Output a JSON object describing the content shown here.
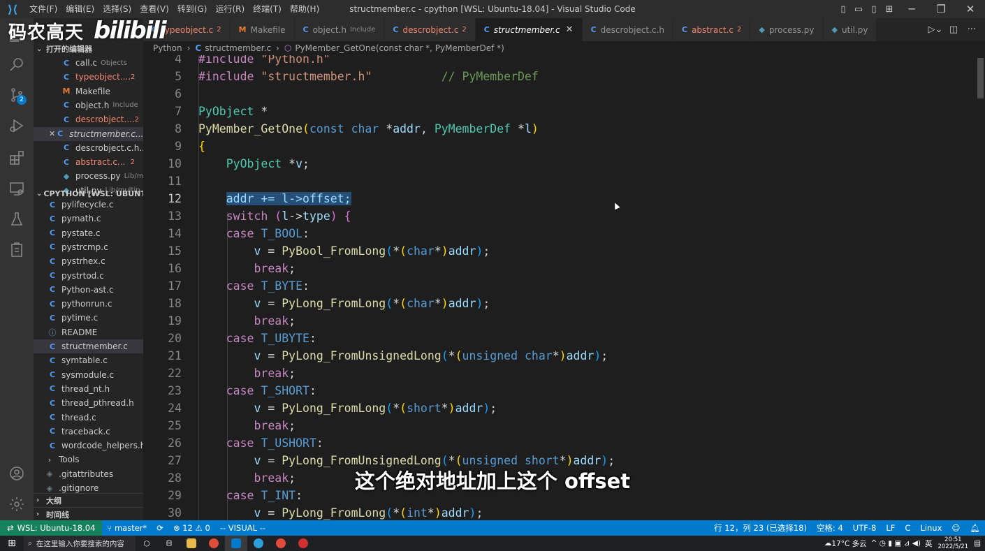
{
  "window": {
    "title": "structmember.c - cpython [WSL: Ubuntu-18.04] - Visual Studio Code",
    "menu": [
      "文件(F)",
      "编辑(E)",
      "选择(S)",
      "查看(V)",
      "转到(G)",
      "运行(R)",
      "终端(T)",
      "帮助(H)"
    ],
    "controls": {
      "minimize": "─",
      "restore": "❐",
      "close": "✕"
    }
  },
  "watermark": {
    "text": "码农高天",
    "logo": "bilibili"
  },
  "subtitle": "这个绝对地址加上这个 offset",
  "activity_bar": {
    "icons": [
      "explorer-icon",
      "search-icon",
      "source-control-icon",
      "run-debug-icon",
      "extensions-icon",
      "remote-explorer-icon",
      "testing-icon",
      "clipboard-icon",
      "account-icon",
      "settings-gear-icon"
    ],
    "source_control_badge": "2"
  },
  "sidebar": {
    "open_editors_header": "打开的编辑器",
    "open_editors": [
      {
        "icon": "C",
        "name": "call.c",
        "desc": "Objects",
        "badge": "",
        "err": false
      },
      {
        "icon": "C",
        "name": "typeobject....",
        "desc": "",
        "badge": "2",
        "err": true
      },
      {
        "icon": "M",
        "name": "Makefile",
        "desc": "",
        "badge": "",
        "err": false
      },
      {
        "icon": "C",
        "name": "object.h",
        "desc": "Include",
        "badge": "",
        "err": false
      },
      {
        "icon": "C",
        "name": "descrobject....",
        "desc": "",
        "badge": "2",
        "err": true
      },
      {
        "icon": "C",
        "name": "structmember.c...",
        "desc": "",
        "badge": "",
        "err": false,
        "active": true
      },
      {
        "icon": "C",
        "name": "descrobject.c.h...",
        "desc": "",
        "badge": "",
        "err": false
      },
      {
        "icon": "C",
        "name": "abstract.c...",
        "desc": "",
        "badge": "2",
        "err": true
      },
      {
        "icon": "PY",
        "name": "process.py",
        "desc": "Lib/m...",
        "badge": "",
        "err": false
      },
      {
        "icon": "PY",
        "name": "util.py",
        "desc": "Lib/multip...",
        "badge": "",
        "err": false
      }
    ],
    "workspace_header": "CPYTHON [WSL: UBUNTU-...",
    "files": [
      {
        "icon": "C",
        "name": "pylifecycle.c"
      },
      {
        "icon": "C",
        "name": "pymath.c"
      },
      {
        "icon": "C",
        "name": "pystate.c"
      },
      {
        "icon": "C",
        "name": "pystrcmp.c"
      },
      {
        "icon": "C",
        "name": "pystrhex.c"
      },
      {
        "icon": "C",
        "name": "pystrtod.c"
      },
      {
        "icon": "C",
        "name": "Python-ast.c"
      },
      {
        "icon": "C",
        "name": "pythonrun.c"
      },
      {
        "icon": "C",
        "name": "pytime.c"
      },
      {
        "icon": "ⓘ",
        "name": "README"
      },
      {
        "icon": "C",
        "name": "structmember.c",
        "active": true
      },
      {
        "icon": "C",
        "name": "symtable.c"
      },
      {
        "icon": "C",
        "name": "sysmodule.c"
      },
      {
        "icon": "C",
        "name": "thread_nt.h"
      },
      {
        "icon": "C",
        "name": "thread_pthread.h"
      },
      {
        "icon": "C",
        "name": "thread.c"
      },
      {
        "icon": "C",
        "name": "traceback.c"
      },
      {
        "icon": "C",
        "name": "wordcode_helpers.h"
      },
      {
        "icon": "›",
        "name": "Tools"
      },
      {
        "icon": "◈",
        "name": ".gitattributes"
      },
      {
        "icon": "◈",
        "name": ".gitignore"
      }
    ],
    "outline_header": "大纲",
    "timeline_header": "时间线"
  },
  "tabs": [
    {
      "icon": "C",
      "name": "typeobject.c",
      "badge": "2",
      "err": true,
      "active": false,
      "desc": ""
    },
    {
      "icon": "M",
      "name": "Makefile",
      "badge": "",
      "err": false,
      "active": false,
      "desc": ""
    },
    {
      "icon": "C",
      "name": "object.h",
      "badge": "",
      "err": false,
      "active": false,
      "desc": "Include"
    },
    {
      "icon": "C",
      "name": "descrobject.c",
      "badge": "2",
      "err": true,
      "active": false,
      "desc": ""
    },
    {
      "icon": "C",
      "name": "structmember.c",
      "badge": "",
      "err": false,
      "active": true,
      "desc": ""
    },
    {
      "icon": "C",
      "name": "descrobject.c.h",
      "badge": "",
      "err": false,
      "active": false,
      "desc": ""
    },
    {
      "icon": "C",
      "name": "abstract.c",
      "badge": "2",
      "err": true,
      "active": false,
      "desc": ""
    },
    {
      "icon": "PY",
      "name": "process.py",
      "badge": "",
      "err": false,
      "active": false,
      "desc": ""
    },
    {
      "icon": "PY",
      "name": "util.py",
      "badge": "",
      "err": false,
      "active": false,
      "desc": ""
    }
  ],
  "breadcrumbs": {
    "folder": "Python",
    "file": "structmember.c",
    "symbol": "PyMember_GetOne(const char *, PyMemberDef *)"
  },
  "editor": {
    "current_line": 12,
    "lines": [
      {
        "n": "4",
        "tokens": [
          [
            "#include",
            "macro"
          ],
          [
            " ",
            "plain"
          ],
          [
            "\"Python.h\"",
            "str"
          ]
        ]
      },
      {
        "n": "5",
        "tokens": [
          [
            "#include",
            "macro"
          ],
          [
            " ",
            "plain"
          ],
          [
            "\"structmember.h\"",
            "str"
          ],
          [
            "          ",
            "plain"
          ],
          [
            "// PyMemberDef",
            "com"
          ]
        ]
      },
      {
        "n": "6",
        "tokens": []
      },
      {
        "n": "7",
        "tokens": [
          [
            "PyObject",
            "type"
          ],
          [
            " *",
            "plain"
          ]
        ]
      },
      {
        "n": "8",
        "tokens": [
          [
            "PyMember_GetOne",
            "fn"
          ],
          [
            "(",
            "brace1"
          ],
          [
            "const",
            "kw"
          ],
          [
            " ",
            "plain"
          ],
          [
            "char",
            "kw"
          ],
          [
            " *",
            "plain"
          ],
          [
            "addr",
            "var"
          ],
          [
            ", ",
            "plain"
          ],
          [
            "PyMemberDef",
            "type"
          ],
          [
            " *",
            "plain"
          ],
          [
            "l",
            "var"
          ],
          [
            ")",
            "brace1"
          ]
        ]
      },
      {
        "n": "9",
        "tokens": [
          [
            "{",
            "brace1"
          ]
        ]
      },
      {
        "n": "10",
        "tokens": [
          [
            "    ",
            "plain"
          ],
          [
            "PyObject",
            "type"
          ],
          [
            " *",
            "plain"
          ],
          [
            "v",
            "var"
          ],
          [
            ";",
            "plain"
          ]
        ]
      },
      {
        "n": "11",
        "tokens": []
      },
      {
        "n": "12",
        "tokens": [
          [
            "    ",
            "plain"
          ],
          [
            "addr += l->offset;",
            "sel"
          ]
        ]
      },
      {
        "n": "13",
        "tokens": [
          [
            "    ",
            "plain"
          ],
          [
            "switch",
            "ctrl"
          ],
          [
            " ",
            "plain"
          ],
          [
            "(",
            "brace2"
          ],
          [
            "l",
            "var"
          ],
          [
            "->",
            "plain"
          ],
          [
            "type",
            "var"
          ],
          [
            ")",
            "brace2"
          ],
          [
            " ",
            "plain"
          ],
          [
            "{",
            "brace2"
          ]
        ]
      },
      {
        "n": "14",
        "tokens": [
          [
            "    ",
            "plain"
          ],
          [
            "case",
            "ctrl"
          ],
          [
            " ",
            "plain"
          ],
          [
            "T_BOOL",
            "kw"
          ],
          [
            ":",
            "plain"
          ]
        ]
      },
      {
        "n": "15",
        "tokens": [
          [
            "        ",
            "plain"
          ],
          [
            "v",
            "var"
          ],
          [
            " = ",
            "plain"
          ],
          [
            "PyBool_FromLong",
            "fn"
          ],
          [
            "(",
            "brace3"
          ],
          [
            "*",
            "plain"
          ],
          [
            "(",
            "brace1"
          ],
          [
            "char",
            "kw"
          ],
          [
            "*",
            "plain"
          ],
          [
            ")",
            "brace1"
          ],
          [
            "addr",
            "var"
          ],
          [
            ")",
            "brace3"
          ],
          [
            ";",
            "plain"
          ]
        ]
      },
      {
        "n": "16",
        "tokens": [
          [
            "        ",
            "plain"
          ],
          [
            "break",
            "ctrl"
          ],
          [
            ";",
            "plain"
          ]
        ]
      },
      {
        "n": "17",
        "tokens": [
          [
            "    ",
            "plain"
          ],
          [
            "case",
            "ctrl"
          ],
          [
            " ",
            "plain"
          ],
          [
            "T_BYTE",
            "kw"
          ],
          [
            ":",
            "plain"
          ]
        ]
      },
      {
        "n": "18",
        "tokens": [
          [
            "        ",
            "plain"
          ],
          [
            "v",
            "var"
          ],
          [
            " = ",
            "plain"
          ],
          [
            "PyLong_FromLong",
            "fn"
          ],
          [
            "(",
            "brace3"
          ],
          [
            "*",
            "plain"
          ],
          [
            "(",
            "brace1"
          ],
          [
            "char",
            "kw"
          ],
          [
            "*",
            "plain"
          ],
          [
            ")",
            "brace1"
          ],
          [
            "addr",
            "var"
          ],
          [
            ")",
            "brace3"
          ],
          [
            ";",
            "plain"
          ]
        ]
      },
      {
        "n": "19",
        "tokens": [
          [
            "        ",
            "plain"
          ],
          [
            "break",
            "ctrl"
          ],
          [
            ";",
            "plain"
          ]
        ]
      },
      {
        "n": "20",
        "tokens": [
          [
            "    ",
            "plain"
          ],
          [
            "case",
            "ctrl"
          ],
          [
            " ",
            "plain"
          ],
          [
            "T_UBYTE",
            "kw"
          ],
          [
            ":",
            "plain"
          ]
        ]
      },
      {
        "n": "21",
        "tokens": [
          [
            "        ",
            "plain"
          ],
          [
            "v",
            "var"
          ],
          [
            " = ",
            "plain"
          ],
          [
            "PyLong_FromUnsignedLong",
            "fn"
          ],
          [
            "(",
            "brace3"
          ],
          [
            "*",
            "plain"
          ],
          [
            "(",
            "brace1"
          ],
          [
            "unsigned",
            "kw"
          ],
          [
            " ",
            "plain"
          ],
          [
            "char",
            "kw"
          ],
          [
            "*",
            "plain"
          ],
          [
            ")",
            "brace1"
          ],
          [
            "addr",
            "var"
          ],
          [
            ")",
            "brace3"
          ],
          [
            ";",
            "plain"
          ]
        ]
      },
      {
        "n": "22",
        "tokens": [
          [
            "        ",
            "plain"
          ],
          [
            "break",
            "ctrl"
          ],
          [
            ";",
            "plain"
          ]
        ]
      },
      {
        "n": "23",
        "tokens": [
          [
            "    ",
            "plain"
          ],
          [
            "case",
            "ctrl"
          ],
          [
            " ",
            "plain"
          ],
          [
            "T_SHORT",
            "kw"
          ],
          [
            ":",
            "plain"
          ]
        ]
      },
      {
        "n": "24",
        "tokens": [
          [
            "        ",
            "plain"
          ],
          [
            "v",
            "var"
          ],
          [
            " = ",
            "plain"
          ],
          [
            "PyLong_FromLong",
            "fn"
          ],
          [
            "(",
            "brace3"
          ],
          [
            "*",
            "plain"
          ],
          [
            "(",
            "brace1"
          ],
          [
            "short",
            "kw"
          ],
          [
            "*",
            "plain"
          ],
          [
            ")",
            "brace1"
          ],
          [
            "addr",
            "var"
          ],
          [
            ")",
            "brace3"
          ],
          [
            ";",
            "plain"
          ]
        ]
      },
      {
        "n": "25",
        "tokens": [
          [
            "        ",
            "plain"
          ],
          [
            "break",
            "ctrl"
          ],
          [
            ";",
            "plain"
          ]
        ]
      },
      {
        "n": "26",
        "tokens": [
          [
            "    ",
            "plain"
          ],
          [
            "case",
            "ctrl"
          ],
          [
            " ",
            "plain"
          ],
          [
            "T_USHORT",
            "kw"
          ],
          [
            ":",
            "plain"
          ]
        ]
      },
      {
        "n": "27",
        "tokens": [
          [
            "        ",
            "plain"
          ],
          [
            "v",
            "var"
          ],
          [
            " = ",
            "plain"
          ],
          [
            "PyLong_FromUnsignedLong",
            "fn"
          ],
          [
            "(",
            "brace3"
          ],
          [
            "*",
            "plain"
          ],
          [
            "(",
            "brace1"
          ],
          [
            "unsigned",
            "kw"
          ],
          [
            " ",
            "plain"
          ],
          [
            "short",
            "kw"
          ],
          [
            "*",
            "plain"
          ],
          [
            ")",
            "brace1"
          ],
          [
            "addr",
            "var"
          ],
          [
            ")",
            "brace3"
          ],
          [
            ";",
            "plain"
          ]
        ]
      },
      {
        "n": "28",
        "tokens": [
          [
            "        ",
            "plain"
          ],
          [
            "break",
            "ctrl"
          ],
          [
            ";",
            "plain"
          ]
        ]
      },
      {
        "n": "29",
        "tokens": [
          [
            "    ",
            "plain"
          ],
          [
            "case",
            "ctrl"
          ],
          [
            " ",
            "plain"
          ],
          [
            "T_INT",
            "kw"
          ],
          [
            ":",
            "plain"
          ]
        ]
      },
      {
        "n": "30",
        "tokens": [
          [
            "        ",
            "plain"
          ],
          [
            "v",
            "var"
          ],
          [
            " = ",
            "plain"
          ],
          [
            "PyLong_FromLong",
            "fn"
          ],
          [
            "(",
            "brace3"
          ],
          [
            "*",
            "plain"
          ],
          [
            "(",
            "brace1"
          ],
          [
            "int",
            "kw"
          ],
          [
            "*",
            "plain"
          ],
          [
            ")",
            "brace1"
          ],
          [
            "addr",
            "var"
          ],
          [
            ")",
            "brace3"
          ],
          [
            ";",
            "plain"
          ]
        ]
      }
    ]
  },
  "statusbar": {
    "remote": "WSL: Ubuntu-18.04",
    "branch": "master*",
    "sync": "⟳",
    "errors": "12",
    "warnings": "0",
    "mode": "-- VISUAL --",
    "position": "行 12，列 23 (已选择18)",
    "spaces": "空格: 4",
    "encoding": "UTF-8",
    "eol": "LF",
    "language": "C",
    "os": "Linux"
  },
  "taskbar": {
    "search_placeholder": "在这里输入你要搜索的内容",
    "weather": "17°C 多云",
    "ime": "英",
    "time": "20:51",
    "date": "2022/5/21"
  },
  "colors": {
    "accent": "#007acc",
    "remote": "#16825d",
    "selection": "#264f78"
  }
}
